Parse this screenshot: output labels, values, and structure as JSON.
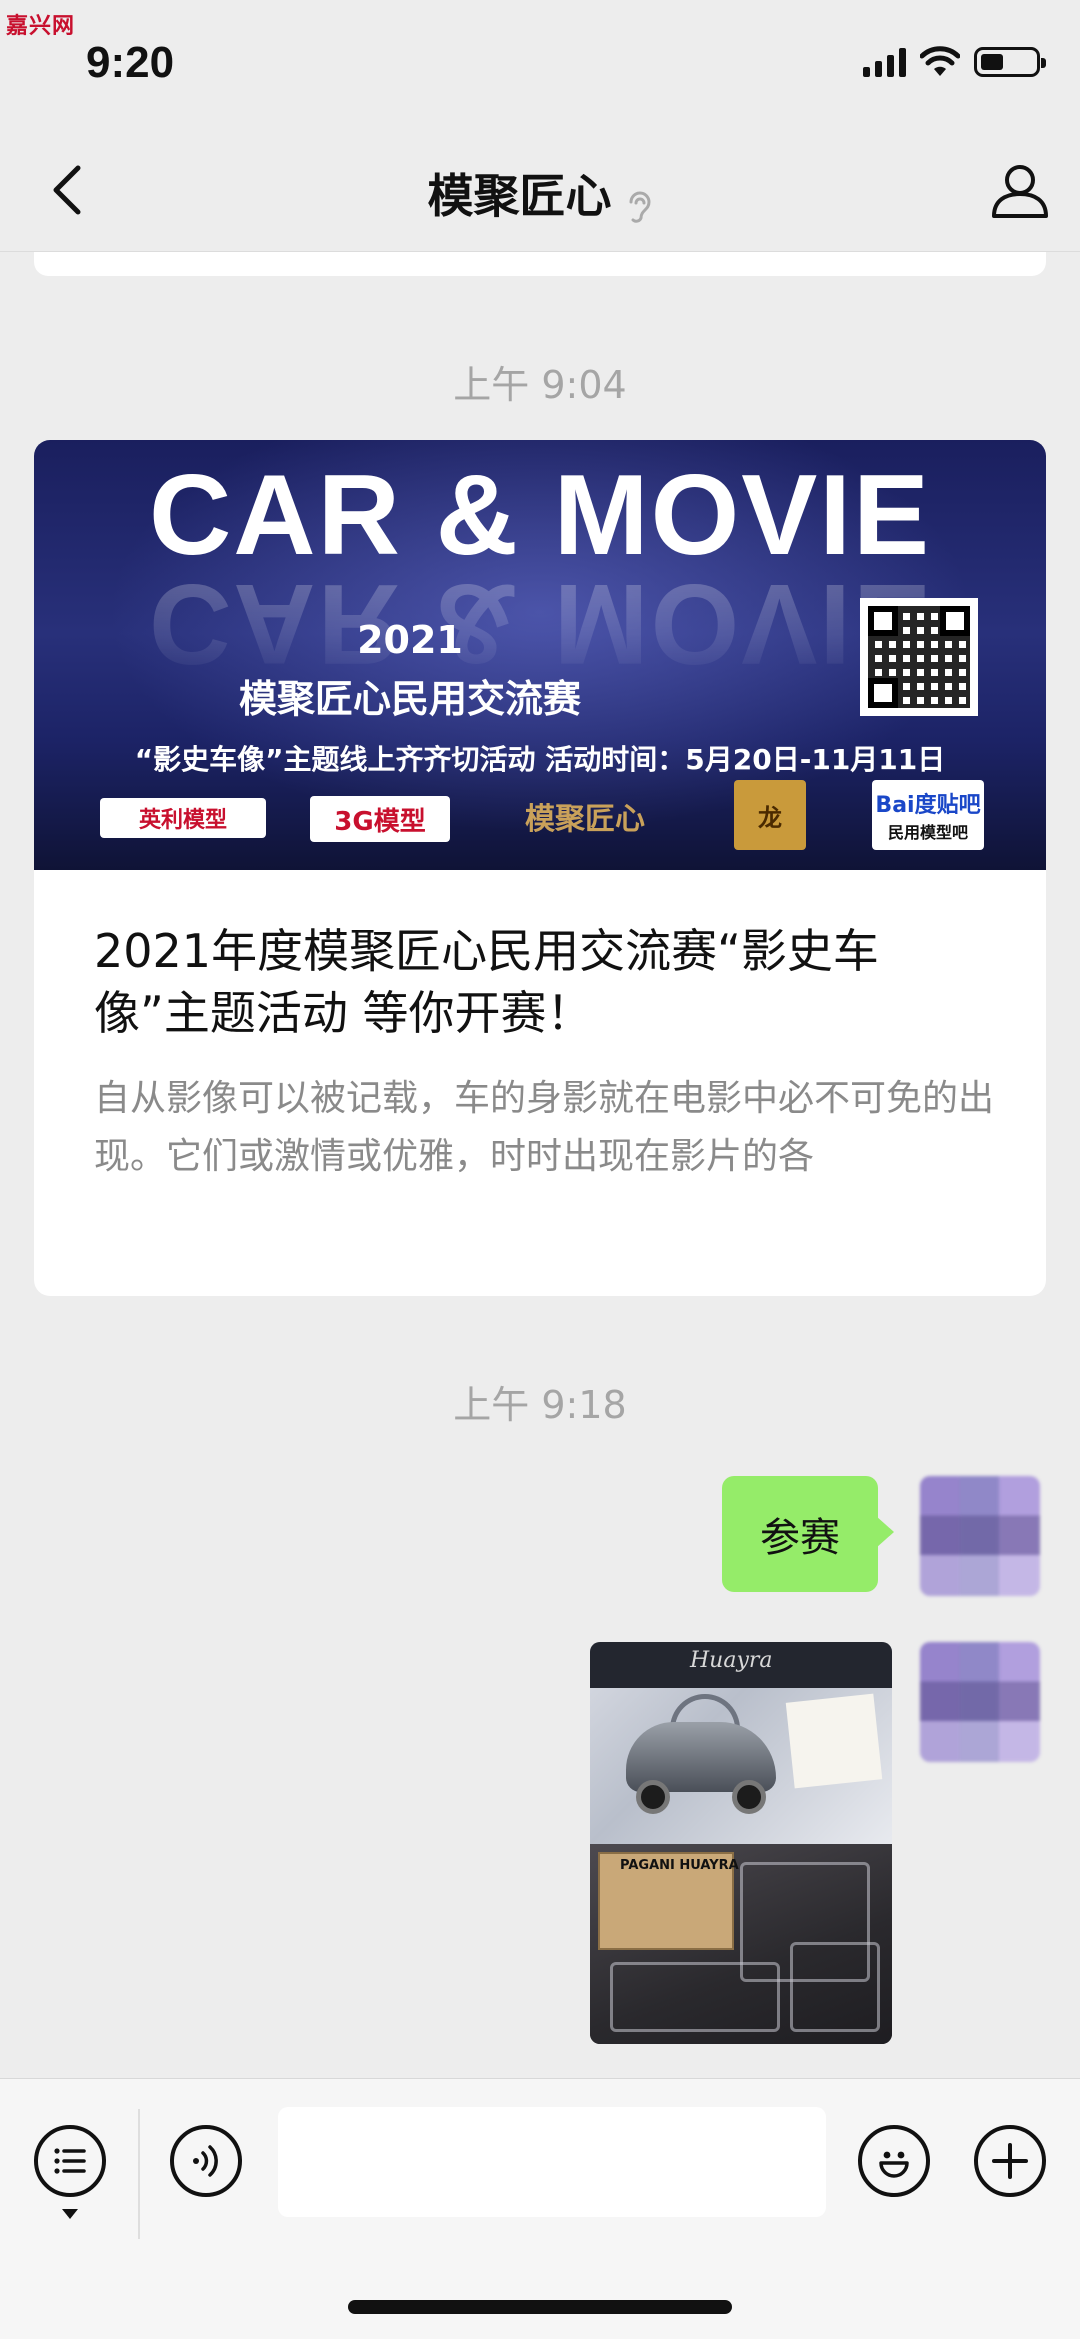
{
  "status_bar": {
    "time": "9:20",
    "watermark": "嘉兴网"
  },
  "nav": {
    "title": "模聚匠心",
    "back_icon": "chevron-left-icon",
    "ear_icon": "ear-icon",
    "profile_icon": "person-icon"
  },
  "messages": [
    {
      "type": "timestamp",
      "text": "上午 9:04"
    },
    {
      "type": "article",
      "banner": {
        "headline": "CAR & MOVIE",
        "year": "2021",
        "subtitle": "模聚匠心民用交流赛",
        "activity": "“影史车像”主题线上齐齐切活动  活动时间：5月20日-11月11日",
        "logos": [
          "英利模型",
          "3G模型",
          "模聚匠心",
          "龙",
          "Bai度贴吧"
        ],
        "logo_5_sub": "民用模型吧"
      },
      "title": "2021年度模聚匠心民用交流赛“影史车像”主题活动 等你开赛！",
      "summary": "自从影像可以被记载，车的身影就在电影中必不可免的出现。它们或激情或优雅，时时出现在影片的各"
    },
    {
      "type": "timestamp",
      "text": "上午 9:18"
    },
    {
      "type": "text",
      "sender": "self",
      "text": "参赛"
    },
    {
      "type": "image",
      "sender": "self",
      "box_brand": "Huayra",
      "manual_label": "PAGANI HUAYRA"
    }
  ],
  "input_bar": {
    "menu_icon": "list-menu-icon",
    "voice_icon": "voice-icon",
    "emoji_icon": "smiley-icon",
    "add_icon": "plus-icon"
  },
  "colors": {
    "background": "#ededed",
    "self_bubble": "#95ec69",
    "timestamp": "#a5a5a5"
  }
}
